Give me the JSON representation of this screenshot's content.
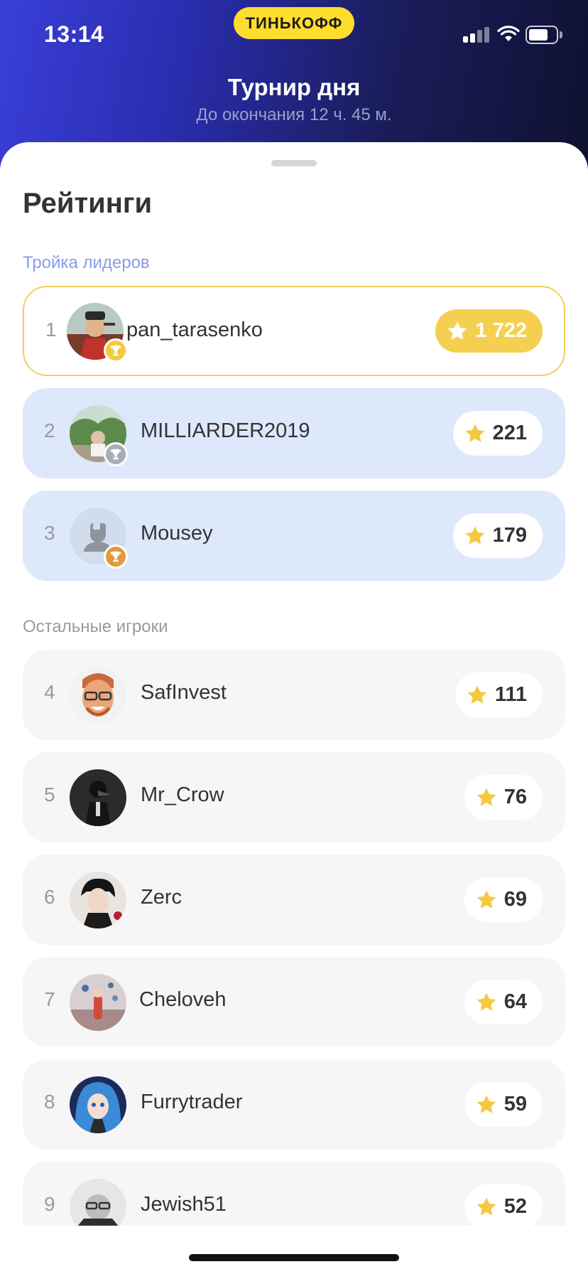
{
  "status_bar": {
    "time": "13:14",
    "brand": "ТИНЬКОФФ"
  },
  "header": {
    "title": "Турнир дня",
    "subtitle": "До окончания 12 ч. 45 м."
  },
  "sheet": {
    "title": "Рейтинги",
    "leaders_label": "Тройка лидеров",
    "others_label": "Остальные игроки"
  },
  "colors": {
    "accent_yellow": "#ffdd2d",
    "gold": "#f5d050",
    "silver": "#a7adb8",
    "bronze": "#e39a3b",
    "leader_bg": "#dde8fb"
  },
  "leaders": [
    {
      "rank": "1",
      "name": "pan_tarasenko",
      "score": "1 722",
      "medal": "gold"
    },
    {
      "rank": "2",
      "name": "MILLIARDER2019",
      "score": "221",
      "medal": "silver"
    },
    {
      "rank": "3",
      "name": "Mousey",
      "score": "179",
      "medal": "bronze"
    }
  ],
  "players": [
    {
      "rank": "4",
      "name": "SafInvest",
      "score": "111"
    },
    {
      "rank": "5",
      "name": "Mr_Crow",
      "score": "76"
    },
    {
      "rank": "6",
      "name": "Zerc",
      "score": "69"
    },
    {
      "rank": "7",
      "name": "Cheloveh",
      "score": "64"
    },
    {
      "rank": "8",
      "name": "Furrytrader",
      "score": "59"
    },
    {
      "rank": "9",
      "name": "Jewish51",
      "score": "52"
    }
  ]
}
